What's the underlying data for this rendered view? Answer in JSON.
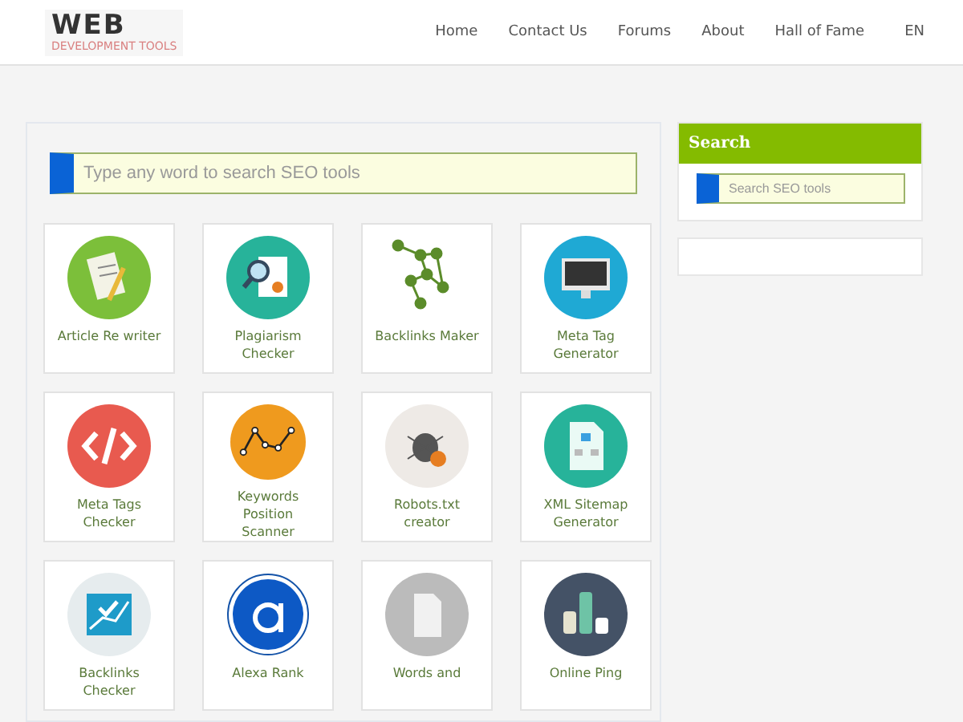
{
  "header": {
    "logo": {
      "title": "WEB",
      "subtitle": "DEVELOPMENT TOOLS"
    },
    "nav": [
      "Home",
      "Contact Us",
      "Forums",
      "About",
      "Hall of Fame",
      "EN"
    ]
  },
  "main_search": {
    "placeholder": "Type any word to search SEO tools"
  },
  "tools": [
    {
      "label": "Article Re writer",
      "kind": "rewriter"
    },
    {
      "label": "Plagiarism Checker",
      "kind": "plagiarism"
    },
    {
      "label": "Backlinks Maker",
      "kind": "network"
    },
    {
      "label": "Meta Tag Generator",
      "kind": "monitor"
    },
    {
      "label": "Meta Tags Checker",
      "kind": "code"
    },
    {
      "label": "Keywords Position Scanner",
      "kind": "linechart"
    },
    {
      "label": "Robots.txt creator",
      "kind": "bug"
    },
    {
      "label": "XML Sitemap Generator",
      "kind": "sitemap"
    },
    {
      "label": "Backlinks Checker",
      "kind": "growth"
    },
    {
      "label": "Alexa Rank",
      "kind": "letter"
    },
    {
      "label": "Words and",
      "kind": "document"
    },
    {
      "label": "Online Ping",
      "kind": "bars"
    }
  ],
  "sidebar": {
    "title": "Search",
    "search": {
      "placeholder": "Search SEO tools"
    }
  }
}
